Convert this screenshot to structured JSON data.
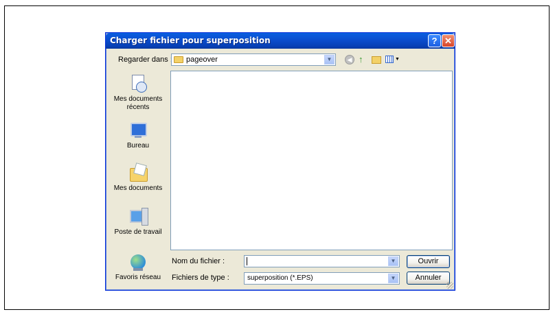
{
  "dialog": {
    "title": "Charger fichier pour superposition",
    "help_glyph": "?",
    "close_glyph": "✕"
  },
  "toolbar": {
    "lookin_label": "Regarder dans :",
    "lookin_value": "pageover",
    "back_icon": "back-icon",
    "up_icon": "up-folder-icon",
    "newfolder_icon": "new-folder-icon",
    "views_icon": "views-menu-icon"
  },
  "places": [
    {
      "label": "Mes documents récents",
      "icon": "recent-documents-icon"
    },
    {
      "label": "Bureau",
      "icon": "desktop-icon"
    },
    {
      "label": "Mes documents",
      "icon": "my-documents-icon"
    },
    {
      "label": "Poste de travail",
      "icon": "my-computer-icon"
    },
    {
      "label": "Favoris réseau",
      "icon": "network-places-icon"
    }
  ],
  "fields": {
    "filename_label": "Nom du fichier :",
    "filename_value": "",
    "filetype_label": "Fichiers de type :",
    "filetype_value": "superposition (*.EPS)"
  },
  "buttons": {
    "open": "Ouvrir",
    "cancel": "Annuler"
  },
  "colors": {
    "titlebar": "#0a5fe0",
    "dialog_bg": "#ece9d8",
    "border": "#7f9db9"
  }
}
